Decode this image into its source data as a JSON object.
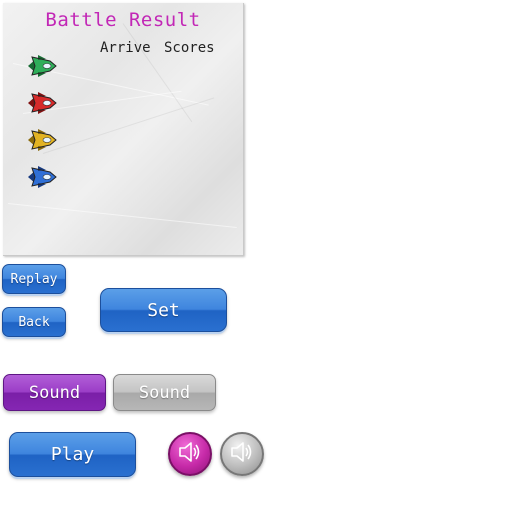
{
  "result_panel": {
    "title": "Battle Result",
    "column_arrive": "Arrive",
    "column_scores": "Scores",
    "ships": [
      {
        "color_name": "green",
        "body": "#2fae5a",
        "dark": "#176b33"
      },
      {
        "color_name": "red",
        "body": "#d62a2a",
        "dark": "#7f1111"
      },
      {
        "color_name": "yellow",
        "body": "#e2b323",
        "dark": "#8a6a0c"
      },
      {
        "color_name": "blue",
        "body": "#2f6fd6",
        "dark": "#16397f"
      }
    ]
  },
  "buttons": {
    "replay": "Replay",
    "back": "Back",
    "set": "Set",
    "sound_on": "Sound",
    "sound_off": "Sound",
    "play": "Play"
  },
  "icons": {
    "sound_on": "speaker-on-icon",
    "sound_off": "speaker-off-icon"
  }
}
